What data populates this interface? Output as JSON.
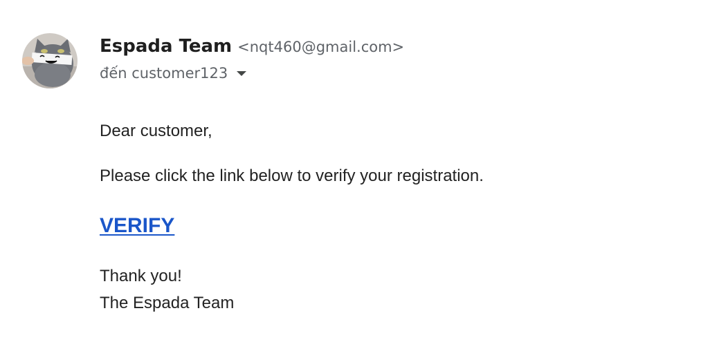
{
  "email": {
    "sender": {
      "name": "Espada Team",
      "address": "<nqt460@gmail.com>",
      "avatar_icon": "cat-avatar"
    },
    "recipient_line": "đến customer123",
    "recipient_toggle_icon": "caret-down-icon",
    "body": {
      "greeting": "Dear customer,",
      "instruction": "Please click the link below to verify your registration.",
      "link_label": "VERIFY",
      "closing": "Thank you!",
      "signature": "The Espada Team"
    }
  },
  "colors": {
    "link": "#1a56c9",
    "secondary_text": "#5f6368",
    "primary_text": "#1f1f1f"
  }
}
